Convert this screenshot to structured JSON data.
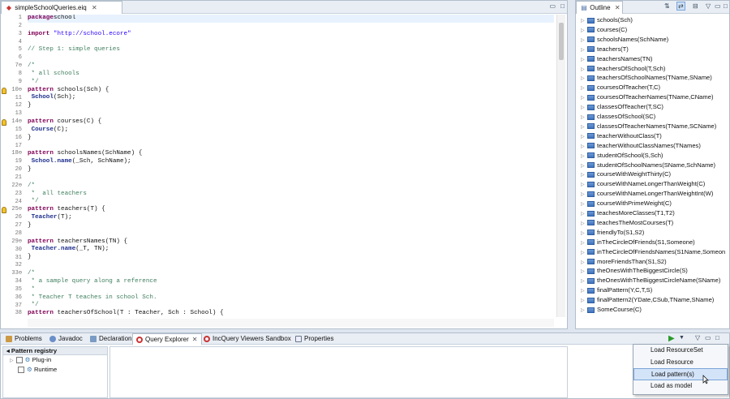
{
  "editor": {
    "tab_label": "simpleSchoolQueries.eiq",
    "lines": [
      {
        "n": "1",
        "segs": [
          [
            "kw",
            "package"
          ],
          [
            "",
            "school"
          ]
        ],
        "cur": true
      },
      {
        "n": "2",
        "segs": [
          [
            "",
            ""
          ]
        ]
      },
      {
        "n": "3",
        "segs": [
          [
            "kw",
            "import"
          ],
          [
            "",
            ""
          ],
          [
            "str",
            "\"http://school.ecore\""
          ]
        ]
      },
      {
        "n": "4",
        "segs": [
          [
            "",
            ""
          ]
        ]
      },
      {
        "n": "5",
        "segs": [
          [
            "cm",
            "// Step 1: simple queries"
          ]
        ]
      },
      {
        "n": "6",
        "segs": [
          [
            "",
            ""
          ]
        ]
      },
      {
        "n": "7⊖",
        "segs": [
          [
            "cm",
            "/*"
          ]
        ]
      },
      {
        "n": "8",
        "segs": [
          [
            "cm",
            " * all schools"
          ]
        ]
      },
      {
        "n": "9",
        "segs": [
          [
            "cm",
            " */"
          ]
        ]
      },
      {
        "n": "10⊖",
        "segs": [
          [
            "kw",
            "pattern"
          ],
          [
            "",
            " schools(Sch) {"
          ]
        ],
        "mark": true
      },
      {
        "n": "11",
        "segs": [
          [
            "",
            " "
          ],
          [
            "ty",
            "School"
          ],
          [
            "",
            "(Sch);"
          ]
        ]
      },
      {
        "n": "12",
        "segs": [
          [
            "",
            "}"
          ]
        ]
      },
      {
        "n": "13",
        "segs": [
          [
            "",
            ""
          ]
        ]
      },
      {
        "n": "14⊖",
        "segs": [
          [
            "kw",
            "pattern"
          ],
          [
            "",
            " courses(C) {"
          ]
        ],
        "mark": true
      },
      {
        "n": "15",
        "segs": [
          [
            "",
            " "
          ],
          [
            "ty",
            "Course"
          ],
          [
            "",
            "(C);"
          ]
        ]
      },
      {
        "n": "16",
        "segs": [
          [
            "",
            "}"
          ]
        ]
      },
      {
        "n": "17",
        "segs": [
          [
            "",
            ""
          ]
        ]
      },
      {
        "n": "18⊖",
        "segs": [
          [
            "kw",
            "pattern"
          ],
          [
            "",
            " schoolsNames(SchName) {"
          ]
        ]
      },
      {
        "n": "19",
        "segs": [
          [
            "",
            " "
          ],
          [
            "ty",
            "School.name"
          ],
          [
            "",
            "(_Sch, SchName);"
          ]
        ]
      },
      {
        "n": "20",
        "segs": [
          [
            "",
            "}"
          ]
        ]
      },
      {
        "n": "21",
        "segs": [
          [
            "",
            ""
          ]
        ]
      },
      {
        "n": "22⊖",
        "segs": [
          [
            "cm",
            "/*"
          ]
        ]
      },
      {
        "n": "23",
        "segs": [
          [
            "cm",
            " *  all teachers"
          ]
        ]
      },
      {
        "n": "24",
        "segs": [
          [
            "cm",
            " */"
          ]
        ]
      },
      {
        "n": "25⊖",
        "segs": [
          [
            "kw",
            "pattern"
          ],
          [
            "",
            " teachers(T) {"
          ]
        ],
        "mark": true
      },
      {
        "n": "26",
        "segs": [
          [
            "",
            " "
          ],
          [
            "ty",
            "Teacher"
          ],
          [
            "",
            "(T);"
          ]
        ]
      },
      {
        "n": "27",
        "segs": [
          [
            "",
            "}"
          ]
        ]
      },
      {
        "n": "28",
        "segs": [
          [
            "",
            ""
          ]
        ]
      },
      {
        "n": "29⊖",
        "segs": [
          [
            "kw",
            "pattern"
          ],
          [
            "",
            " teachersNames(TN) {"
          ]
        ]
      },
      {
        "n": "30",
        "segs": [
          [
            "",
            " "
          ],
          [
            "ty",
            "Teacher.name"
          ],
          [
            "",
            "(_T, TN);"
          ]
        ]
      },
      {
        "n": "31",
        "segs": [
          [
            "",
            "}"
          ]
        ]
      },
      {
        "n": "32",
        "segs": [
          [
            "",
            ""
          ]
        ]
      },
      {
        "n": "33⊖",
        "segs": [
          [
            "cm",
            "/*"
          ]
        ]
      },
      {
        "n": "34",
        "segs": [
          [
            "cm",
            " * a sample query along a reference"
          ]
        ]
      },
      {
        "n": "35",
        "segs": [
          [
            "cm",
            " *"
          ]
        ]
      },
      {
        "n": "36",
        "segs": [
          [
            "cm",
            " * Teacher T teaches in school Sch."
          ]
        ]
      },
      {
        "n": "37",
        "segs": [
          [
            "cm",
            " */"
          ]
        ]
      },
      {
        "n": "38",
        "segs": [
          [
            "kw",
            "pattern"
          ],
          [
            "",
            " teachersOfSchool(T : Teacher, Sch : School) {"
          ]
        ]
      }
    ]
  },
  "outline": {
    "tab_label": "Outline",
    "items": [
      "schools(Sch)",
      "courses(C)",
      "schoolsNames(SchName)",
      "teachers(T)",
      "teachersNames(TN)",
      "teachersOfSchool(T,Sch)",
      "teachersOfSchoolNames(TName,SName)",
      "coursesOfTeacher(T,C)",
      "coursesOfTeacherNames(TName,CName)",
      "classesOfTeacher(T,SC)",
      "classesOfSchool(SC)",
      "classesOfTeacherNames(TName,SCName)",
      "teacherWithoutClass(T)",
      "teacherWithoutClassNames(TNames)",
      "studentOfSchool(S,Sch)",
      "studentOfSchoolNames(SName,SchName)",
      "courseWithWeightThirty(C)",
      "courseWithNameLongerThanWeight(C)",
      "courseWithNameLongerThanWeightInt(W)",
      "courseWithPrimeWeight(C)",
      "teachesMoreClasses(T1,T2)",
      "teachesTheMostCourses(T)",
      "friendlyTo(S1,S2)",
      "inTheCircleOfFriends(S1,Someone)",
      "inTheCircleOfFriendsNames(S1Name,Someon",
      "moreFriendsThan(S1,S2)",
      "theOnesWithTheBiggestCircle(S)",
      "theOnesWithTheBiggestCircleName(SName)",
      "finalPattern(Y,C,T,S)",
      "finalPattern2(YDate,CSub,TName,SName)",
      "SomeCourse(C)"
    ]
  },
  "bottom": {
    "tabs": [
      "Problems",
      "Javadoc",
      "Declaration",
      "Query Explorer",
      "IncQuery Viewers Sandbox",
      "Properties"
    ],
    "registry_header": "Pattern registry",
    "registry_items": [
      "Plug-in",
      "Runtime"
    ]
  },
  "menu": {
    "items": [
      "Load ResourceSet",
      "Load Resource",
      "Load pattern(s)",
      "Load as model"
    ],
    "selected": "Load pattern(s)"
  },
  "colors": {
    "keyword": "#7f0055",
    "string": "#2a00ff",
    "comment": "#3f7f5f",
    "type": "#1d2e8c",
    "highlight": "#d3e3f8"
  }
}
